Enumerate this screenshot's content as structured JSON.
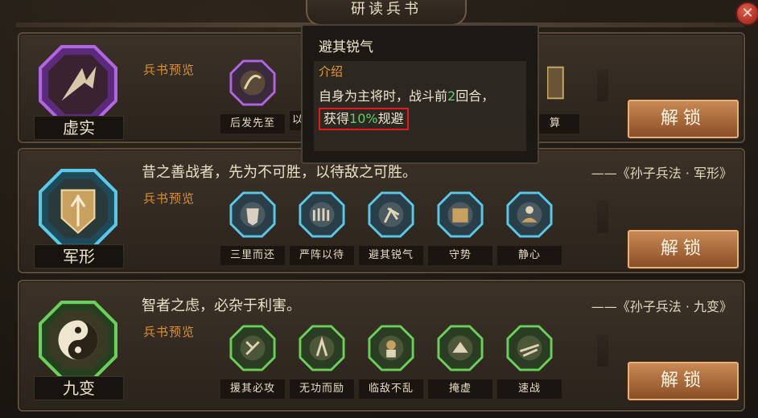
{
  "window": {
    "title": "研读兵书",
    "close_symbol": "✕"
  },
  "tooltip": {
    "title": "避其锐气",
    "section_label": "介绍",
    "desc_part1": "自身为主将时，战斗前",
    "desc_num1": "2",
    "desc_part2": "回合，",
    "desc_hl_prefix": "获得",
    "desc_hl_num": "10%",
    "desc_hl_suffix": "规避"
  },
  "cards": [
    {
      "emblem_label": "虚实",
      "emblem_color": "#8a3fc0",
      "preview_label": "兵书预览",
      "skills": [
        {
          "name": "后发先至",
          "icon": "arc-arrow-icon"
        },
        {
          "name": "以",
          "icon": "scroll-icon"
        },
        {
          "name": "算",
          "icon": "abacus-icon"
        }
      ],
      "unlock_label": "解锁"
    },
    {
      "emblem_label": "军形",
      "emblem_color": "#3aa0c0",
      "quote": "昔之善战者，先为不可胜，以待敌之可胜。",
      "source": "——《孙子兵法 · 军形》",
      "preview_label": "兵书预览",
      "skills": [
        {
          "name": "三里而还",
          "icon": "shield-icon"
        },
        {
          "name": "严阵以待",
          "icon": "formation-icon"
        },
        {
          "name": "避其锐气",
          "icon": "dodge-icon"
        },
        {
          "name": "守势",
          "icon": "guard-icon"
        },
        {
          "name": "静心",
          "icon": "meditate-icon"
        }
      ],
      "unlock_label": "解锁"
    },
    {
      "emblem_label": "九变",
      "emblem_color": "#3fa844",
      "quote": "智者之虑，必杂于利害。",
      "source": "——《孙子兵法 · 九变》",
      "preview_label": "兵书预览",
      "skills": [
        {
          "name": "援其必攻",
          "icon": "rescue-icon"
        },
        {
          "name": "无功而励",
          "icon": "encourage-icon"
        },
        {
          "name": "临敌不乱",
          "icon": "calm-icon"
        },
        {
          "name": "掩虚",
          "icon": "ambush-icon"
        },
        {
          "name": "速战",
          "icon": "swift-icon"
        }
      ],
      "unlock_label": "解锁"
    }
  ]
}
